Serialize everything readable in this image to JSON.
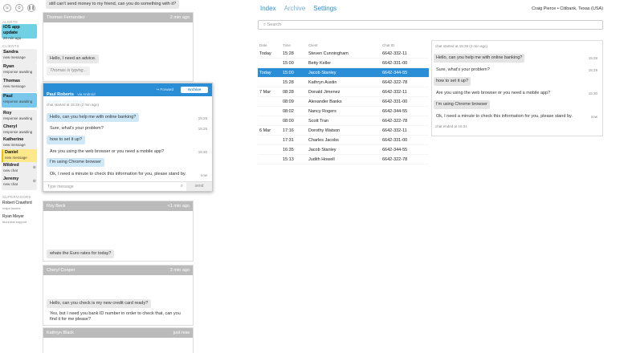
{
  "left": {
    "icons": [
      "phone-icon",
      "settings-icon",
      "pause-icon"
    ],
    "alerts_label": "ALERTS",
    "alert": {
      "title": "iOS app update",
      "sub": "20 min ago"
    },
    "clients_label": "CLIENTS",
    "clients": [
      {
        "name": "Sandra",
        "status": "new message"
      },
      {
        "name": "Ryan",
        "status": "response awaiting"
      },
      {
        "name": "Thomas",
        "status": "new message"
      },
      {
        "name": "Paul",
        "status": "response awaiting"
      },
      {
        "name": "Roy",
        "status": "response awaiting"
      },
      {
        "name": "Cheryl",
        "status": "response awaiting"
      },
      {
        "name": "Katherine",
        "status": "new message"
      },
      {
        "name": "Daniel",
        "status": "new message"
      },
      {
        "name": "Mildred",
        "status": "new chat"
      },
      {
        "name": "Jeremy",
        "status": "new chat"
      }
    ],
    "supervisors_label": "SUPERVISORS",
    "supervisors": [
      {
        "name": "Robert Crawford",
        "role": "major issues"
      },
      {
        "name": "Ryan Meyer",
        "role": "technical support"
      }
    ]
  },
  "chats": {
    "top_text": "still can't send money to my friend, can you do something with it?",
    "thomas": {
      "name": "Thomas Fernandez",
      "time": "2 min ago",
      "msg": "Hello, I need an advice.",
      "typing": "Thomas is typing..."
    },
    "roy": {
      "name": "Roy Beck",
      "time": "<1 min ago",
      "msg": "whats the Euro rates for today?"
    },
    "cheryl": {
      "name": "Cheryl Cooper",
      "time": "2 min ago",
      "msg1": "Hello, can you check is my new credit card ready?",
      "msg2a": "Yes, but I need you bank ID number in order to check that, can you",
      "msg2b": "find it for me please?"
    },
    "katheryn": {
      "name": "Kathryn Black",
      "time": "just now"
    }
  },
  "active": {
    "name": "Paul Roberts",
    "platform": "via Android",
    "location": "Location: Austin (15:20)",
    "forward": "Forward",
    "archive": "Archive",
    "started": "chat started at 15:28 (2 min ago)",
    "messages": [
      {
        "text": "Hello, can you help me with online banking?",
        "time": "15:28",
        "me": true
      },
      {
        "text": "Sure, what's your problem?",
        "time": "15:29",
        "me": false
      },
      {
        "text": "how to set it up?",
        "time": "",
        "me": true
      },
      {
        "text": "Are you using the web browser or you need a mobile app?",
        "time": "15:30",
        "me": false
      },
      {
        "text": "I'm using Chrome browser",
        "time": "",
        "me": true
      },
      {
        "text": "Ok, I need a minute to check this information for you, please stand by.",
        "time": "now",
        "me": false
      }
    ],
    "placeholder": "Type message",
    "send": "send"
  },
  "right": {
    "nav": [
      "Index",
      "Archive",
      "Settings"
    ],
    "user": "Craig Pierce • Citibank, Texas (USA)",
    "search_placeholder": "Search",
    "headers": [
      "Date",
      "Time",
      "Client",
      "Chat ID"
    ],
    "rows": [
      [
        "Today",
        "15:28",
        "Steven Cunningham",
        "6642-332-11"
      ],
      [
        "",
        "15:00",
        "Betty Keller",
        "6642-331-00"
      ],
      [
        "Today",
        "15:00",
        "Jacob Stanley",
        "6642-344-55"
      ],
      [
        "",
        "15:28",
        "Kathryn Austin",
        "6642-322-78"
      ],
      [
        "7 Mar",
        "08:28",
        "Donald Jimenez",
        "6642-332-11"
      ],
      [
        "",
        "08:09",
        "Alexander Banks",
        "6642-331-00"
      ],
      [
        "",
        "08:02",
        "Nancy Rogers",
        "6642-344-55"
      ],
      [
        "",
        "08:00",
        "Scott Tran",
        "6642-322-78"
      ],
      [
        "6 Mar",
        "17:16",
        "Dorothy Watson",
        "6642-332-11"
      ],
      [
        "",
        "17:31",
        "Charles Jacobs",
        "6642-331-00"
      ],
      [
        "",
        "16:35",
        "Jacob Stanley",
        "6642-344-55"
      ],
      [
        "",
        "15:13",
        "Judith Howell",
        "6642-322-78"
      ]
    ],
    "selected_row": 2,
    "transcript": {
      "started": "chat started at 15:28 (2 min ago)",
      "messages": [
        {
          "text": "Hello, can you help me with online banking?",
          "time": "15:28",
          "g": true
        },
        {
          "text": "Sure, what's your problem?",
          "time": "15:29",
          "g": false
        },
        {
          "text": "how to set it up?",
          "time": "",
          "g": true
        },
        {
          "text": "Are you using the web browser or you need a mobile app?",
          "time": "15:30",
          "g": false
        },
        {
          "text": "I'm using Chrome browser",
          "time": "",
          "g": true
        },
        {
          "text": "Ok, I need a minute to check this information for you, please stand by.",
          "time": "now",
          "g": false
        }
      ],
      "ended": "chat ended at 15:31"
    }
  }
}
